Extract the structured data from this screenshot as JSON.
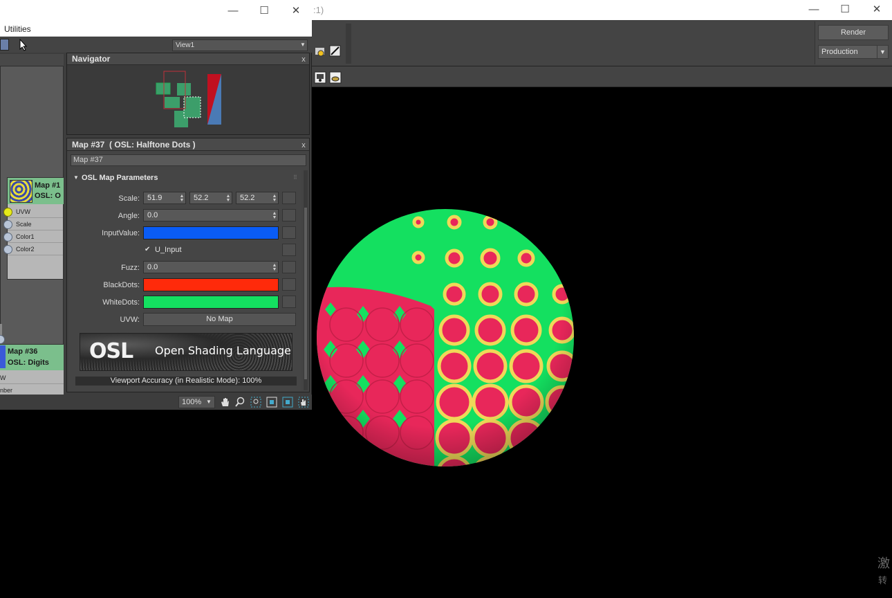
{
  "render_window": {
    "title_fragment": ":1)",
    "controls": {
      "minimize": "—",
      "maximize": "☐",
      "close": "✕"
    },
    "render_button": "Render",
    "preset": "Production",
    "preset_arrow": "▼",
    "watermark_line1": "激",
    "watermark_line2": "转"
  },
  "slate": {
    "controls": {
      "minimize": "—",
      "maximize": "☐",
      "close": "✕"
    },
    "menu": {
      "utilities": "Utilities"
    },
    "view_select": "View1",
    "view_arrow": "▼",
    "nodes": [
      {
        "title": "Map #1",
        "subtitle": "OSL: O",
        "ports": [
          "UVW",
          "Scale",
          "Color1",
          "Color2"
        ]
      },
      {
        "title": "Map #36",
        "subtitle": "OSL: Digits",
        "ports": [
          "W",
          "nber"
        ]
      }
    ],
    "navigator": {
      "title": "Navigator",
      "close": "x"
    },
    "params": {
      "title": "Map #37  ( OSL: Halftone Dots )",
      "close": "x",
      "map_name": "Map #37",
      "rollout": {
        "title": "OSL Map Parameters",
        "arrow": "▼",
        "grip": "⠿"
      },
      "fields": {
        "scale_label": "Scale:",
        "scale_values": [
          "51.9",
          "52.2",
          "52.2"
        ],
        "angle_label": "Angle:",
        "angle_value": "0.0",
        "input_value_label": "InputValue:",
        "input_value_color": "#0a5cf5",
        "u_input_label": "U_Input",
        "u_input_checked": "✔",
        "fuzz_label": "Fuzz:",
        "fuzz_value": "0.0",
        "black_dots_label": "BlackDots:",
        "black_dots_color": "#ff2a0a",
        "white_dots_label": "WhiteDots:",
        "white_dots_color": "#14e060",
        "uvw_label": "UVW:",
        "uvw_value": "No Map"
      },
      "osl_banner": {
        "logo": "OSL",
        "text": "Open Shading Language"
      },
      "accuracy": "Viewport Accuracy (in Realistic Mode): 100%"
    },
    "zoom": "100%",
    "zoom_arrow": "▼"
  },
  "colors": {
    "sphere_green": "#14e060",
    "sphere_pink": "#e8275a",
    "dot_yellow": "#f0d858"
  }
}
